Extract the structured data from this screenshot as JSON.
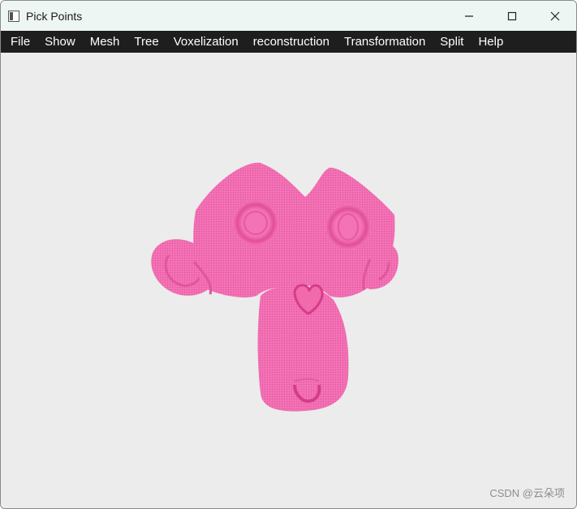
{
  "window": {
    "title": "Pick Points",
    "controls": {
      "minimize": "minimize",
      "maximize": "maximize",
      "close": "close"
    }
  },
  "menu": {
    "items": [
      "File",
      "Show",
      "Mesh",
      "Tree",
      "Voxelization",
      "reconstruction",
      "Transformation",
      "Split",
      "Help"
    ]
  },
  "viewport": {
    "model": "monkey-head-point-cloud",
    "point_color": "#f472b6",
    "background": "#ececec"
  },
  "watermark": "CSDN @云朵项"
}
